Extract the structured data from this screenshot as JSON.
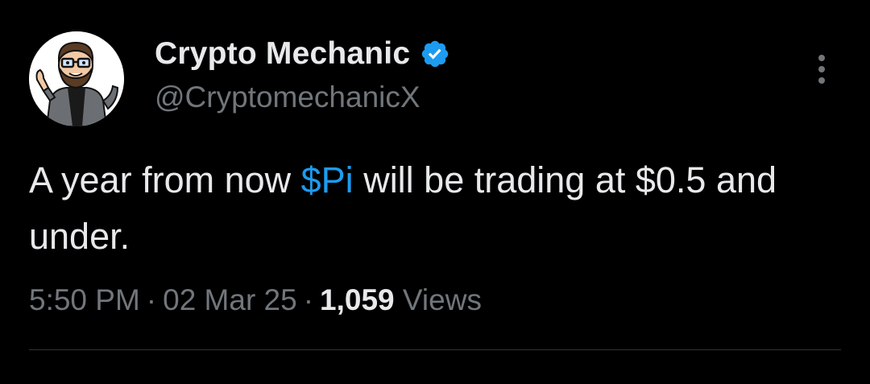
{
  "author": {
    "display_name": "Crypto Mechanic",
    "handle": "@CryptomechanicX",
    "verified": true,
    "avatar_icon": "cartoon-mechanic-avatar"
  },
  "tweet": {
    "text_before": "A year from now ",
    "cashtag": "$Pi",
    "text_after": " will be trading at $0.5 and under."
  },
  "meta": {
    "time": "5:50 PM",
    "separator": "·",
    "date": "02 Mar 25",
    "views_count": "1,059",
    "views_label": " Views"
  },
  "colors": {
    "background": "#000000",
    "primary_text": "#e7e9ea",
    "secondary_text": "#71767b",
    "accent": "#1d9bf0",
    "divider": "#2f3336"
  },
  "icons": {
    "verified": "verified-badge-icon",
    "more": "more-options-icon"
  }
}
